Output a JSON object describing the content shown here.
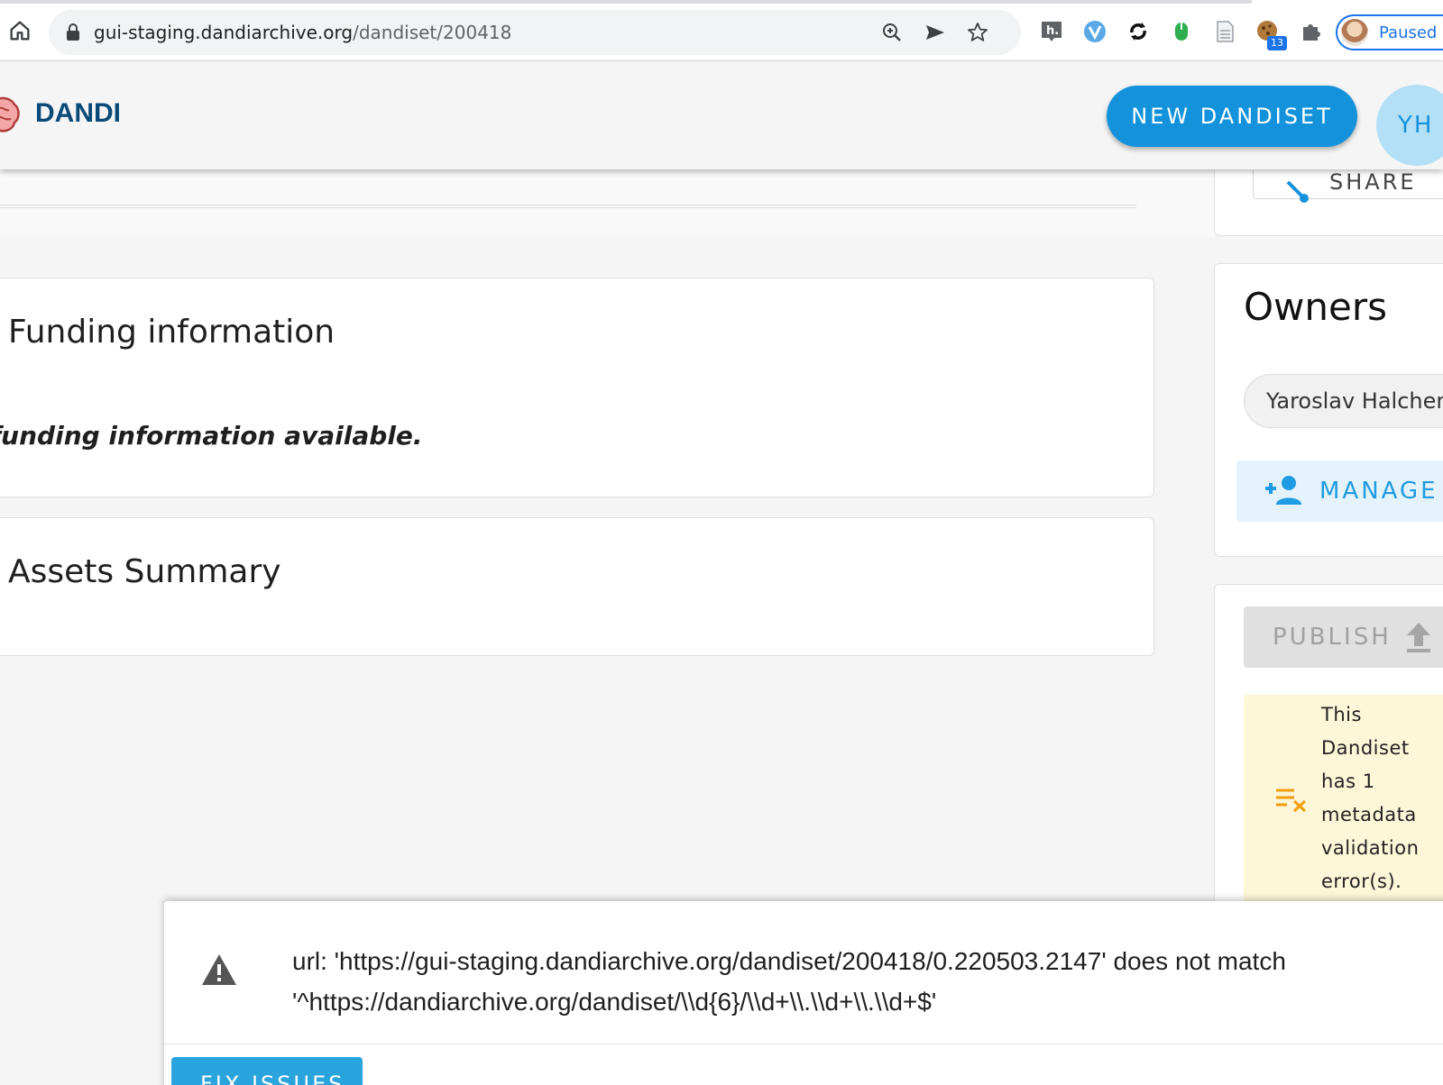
{
  "browser": {
    "url_host": "gui-staging.dandiarchive.org",
    "url_path": "/dandiset/200418",
    "profile_label": "Paused",
    "extension_badge": "13"
  },
  "appbar": {
    "brand": "DANDI",
    "new_dandiset_label": "NEW DANDISET",
    "user_initials": "YH"
  },
  "main": {
    "funding_title": "Funding information",
    "funding_note": "funding information available.",
    "assets_title": "Assets Summary"
  },
  "sidebar": {
    "share_label": "SHARE",
    "owners_title": "Owners",
    "owner_name": "Yaroslav Halchen",
    "manage_owners_label": "MANAGE O",
    "publish_label": "PUBLISH",
    "validation_message": "This Dandiset has 1 metadata validation error(s)."
  },
  "issues": {
    "message": "url: 'https://gui-staging.dandiarchive.org/dandiset/200418/0.220503.2147' does not match '^https://dandiarchive.org/dandiset/\\\\d{6}/\\\\d+\\\\.\\\\d+\\\\.\\\\d+$'",
    "fix_label": "FIX ISSUES"
  },
  "colors": {
    "primary": "#1492db",
    "brand_text": "#0a4a78",
    "warning_bg": "#fdf6d8",
    "warning_icon": "#f29d0e"
  }
}
